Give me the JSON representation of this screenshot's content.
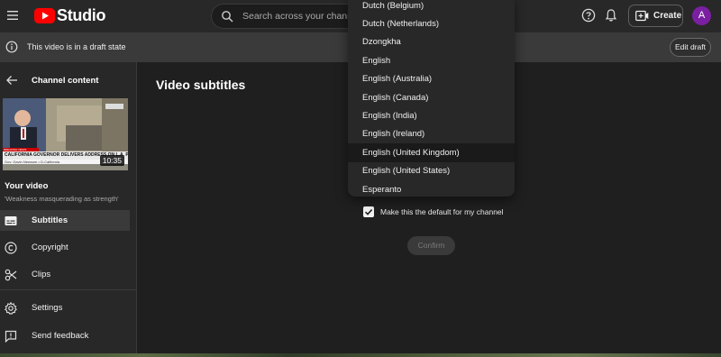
{
  "header": {
    "brand": "Studio",
    "search_placeholder": "Search across your channel",
    "create_label": "Create",
    "avatar_initial": "A"
  },
  "banner": {
    "text": "This video is in a draft state",
    "edit_draft_label": "Edit draft"
  },
  "sidebar": {
    "heading": "Channel content",
    "thumbnail": {
      "duration": "10:35",
      "breaking": "BREAKING NEWS",
      "chyron": "CALIFORNIA GOVERNOR DELIVERS ADDRESS ON L.A. PROTESTS",
      "subchyron": "Gov. Gavin Newsom  •  D-California"
    },
    "your_video_label": "Your video",
    "video_title": "'Weakness masquerading as strength'",
    "items": [
      {
        "label": "Subtitles",
        "icon": "subtitles-icon",
        "active": true
      },
      {
        "label": "Copyright",
        "icon": "copyright-icon",
        "active": false
      },
      {
        "label": "Clips",
        "icon": "scissors-icon",
        "active": false
      },
      {
        "label": "Settings",
        "icon": "gear-icon",
        "active": false
      },
      {
        "label": "Send feedback",
        "icon": "feedback-icon",
        "active": false
      }
    ]
  },
  "main": {
    "title": "Video subtitles",
    "default_checkbox_label": "Make this the default for my channel",
    "default_checked": true,
    "confirm_label": "Confirm"
  },
  "language_dropdown": {
    "options": [
      "Dutch (Belgium)",
      "Dutch (Netherlands)",
      "Dzongkha",
      "English",
      "English (Australia)",
      "English (Canada)",
      "English (India)",
      "English (Ireland)",
      "English (United Kingdom)",
      "English (United States)",
      "Esperanto"
    ],
    "highlighted": "English (United Kingdom)"
  },
  "colors": {
    "brand_red": "#ff0000",
    "avatar_bg": "#7b1fa2",
    "background": "#1f1f1f",
    "surface": "#282828"
  }
}
